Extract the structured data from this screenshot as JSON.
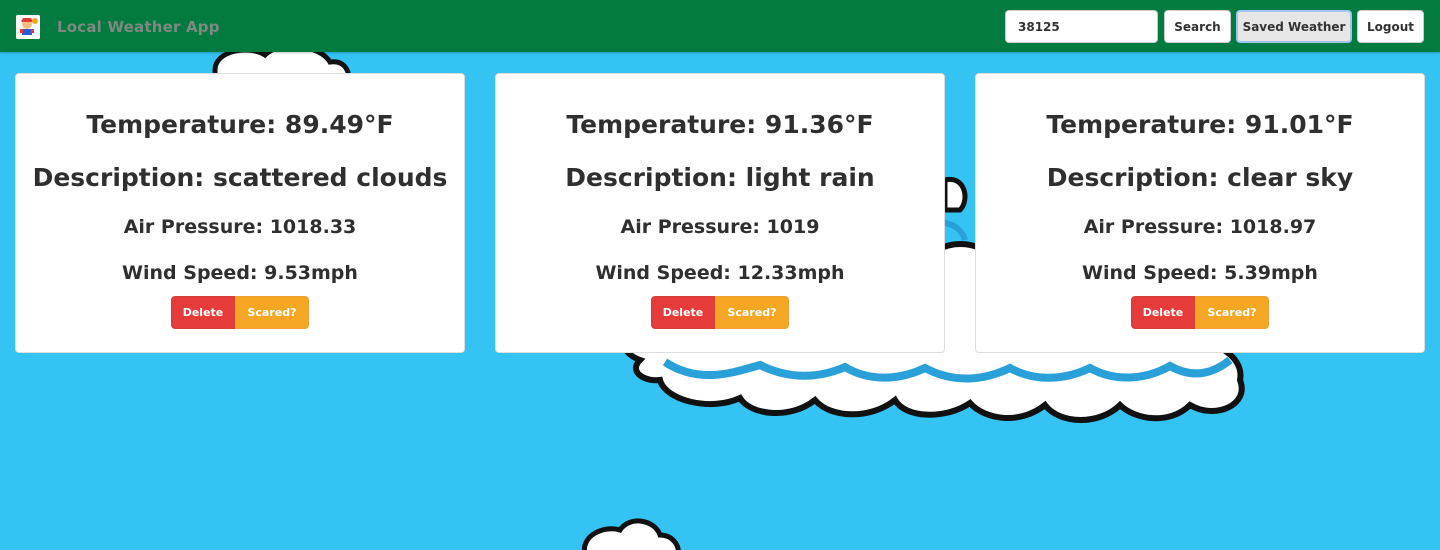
{
  "navbar": {
    "brand": "Local Weather App",
    "search_value": "38125",
    "search_button": "Search",
    "saved_button": "Saved Weather",
    "logout_button": "Logout",
    "accent_color": "#027a40"
  },
  "cards": [
    {
      "temperature": "Temperature: 89.49°F",
      "description": "Description: scattered clouds",
      "pressure": "Air Pressure: 1018.33",
      "wind": "Wind Speed: 9.53mph",
      "delete_label": "Delete",
      "scared_label": "Scared?"
    },
    {
      "temperature": "Temperature: 91.36°F",
      "description": "Description: light rain",
      "pressure": "Air Pressure: 1019",
      "wind": "Wind Speed: 12.33mph",
      "delete_label": "Delete",
      "scared_label": "Scared?"
    },
    {
      "temperature": "Temperature: 91.01°F",
      "description": "Description: clear sky",
      "pressure": "Air Pressure: 1018.97",
      "wind": "Wind Speed: 5.39mph",
      "delete_label": "Delete",
      "scared_label": "Scared?"
    }
  ],
  "colors": {
    "background_sky": "#34c3f3",
    "delete": "#e53b3b",
    "scared": "#f5a623"
  }
}
